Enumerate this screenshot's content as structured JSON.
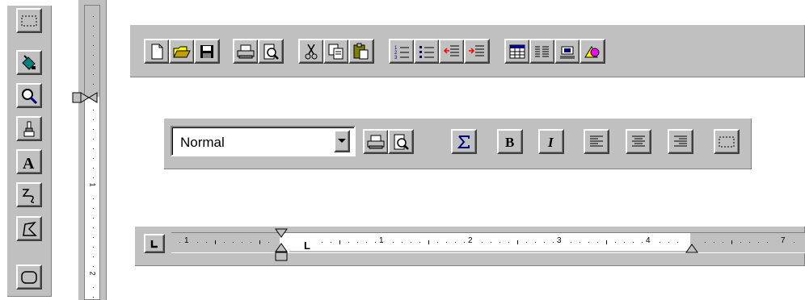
{
  "style_box": {
    "value": "Normal"
  },
  "ruler": {
    "left_tab_stop_symbol": "L",
    "labels": [
      "1",
      "1",
      "2",
      "3",
      "4",
      "7"
    ]
  },
  "vertical_ruler": {
    "labels": [
      "1",
      "2"
    ]
  },
  "colors": {
    "face": "#c0c0c0",
    "highlight": "#ffffff",
    "shadow": "#808080",
    "dark": "#404040",
    "accent_blue": "#000080",
    "accent_red": "#ff0000",
    "accent_yellow": "#ffff00",
    "accent_magenta": "#ff00ff"
  }
}
